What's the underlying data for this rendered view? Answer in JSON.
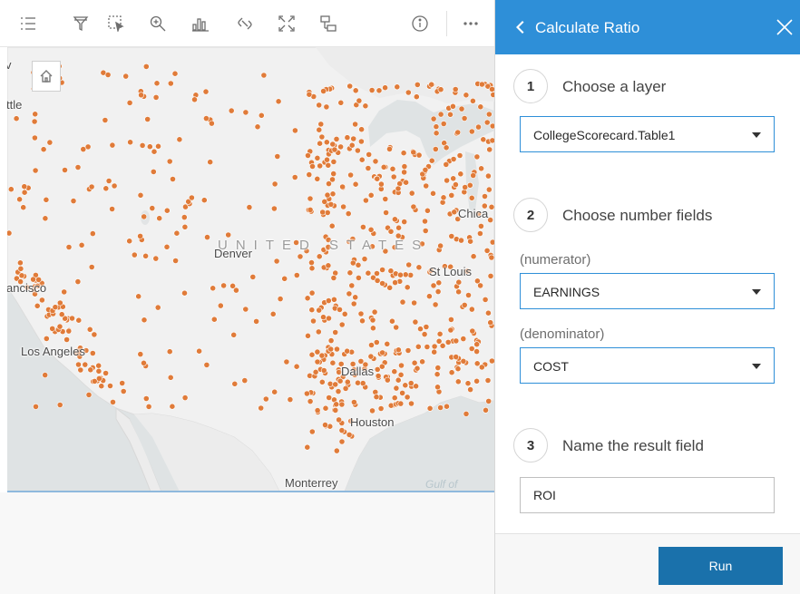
{
  "toolbar": {
    "tools": [
      "list-icon",
      "filter-icon",
      "select-icon",
      "zoom-icon",
      "chart-icon",
      "link-icon",
      "extent-icon",
      "layers-icon",
      "info-icon",
      "more-icon"
    ]
  },
  "map": {
    "labels": {
      "seattle": "ttle",
      "top_left": "v",
      "chicago": "Chica",
      "denver": "Denver",
      "united_states": "UNITED STATES",
      "st_louis": "St Louis",
      "san_francisco": "ancisco",
      "los_angeles": "Los Angeles",
      "dallas": "Dallas",
      "houston": "Houston",
      "monterrey": "Monterrey",
      "gulf": "Gulf of"
    },
    "point_color": "#e07b39"
  },
  "panel": {
    "title": "Calculate Ratio",
    "step1": {
      "number": "1",
      "label": "Choose a layer",
      "layer_value": "CollegeScorecard.Table1"
    },
    "step2": {
      "number": "2",
      "label": "Choose number fields",
      "numerator_label": "(numerator)",
      "numerator_value": "EARNINGS",
      "denominator_label": "(denominator)",
      "denominator_value": "COST"
    },
    "step3": {
      "number": "3",
      "label": "Name the result field",
      "result_value": "ROI"
    },
    "run_label": "Run",
    "accent_color": "#2e8fd8",
    "run_color": "#1a71ab"
  }
}
